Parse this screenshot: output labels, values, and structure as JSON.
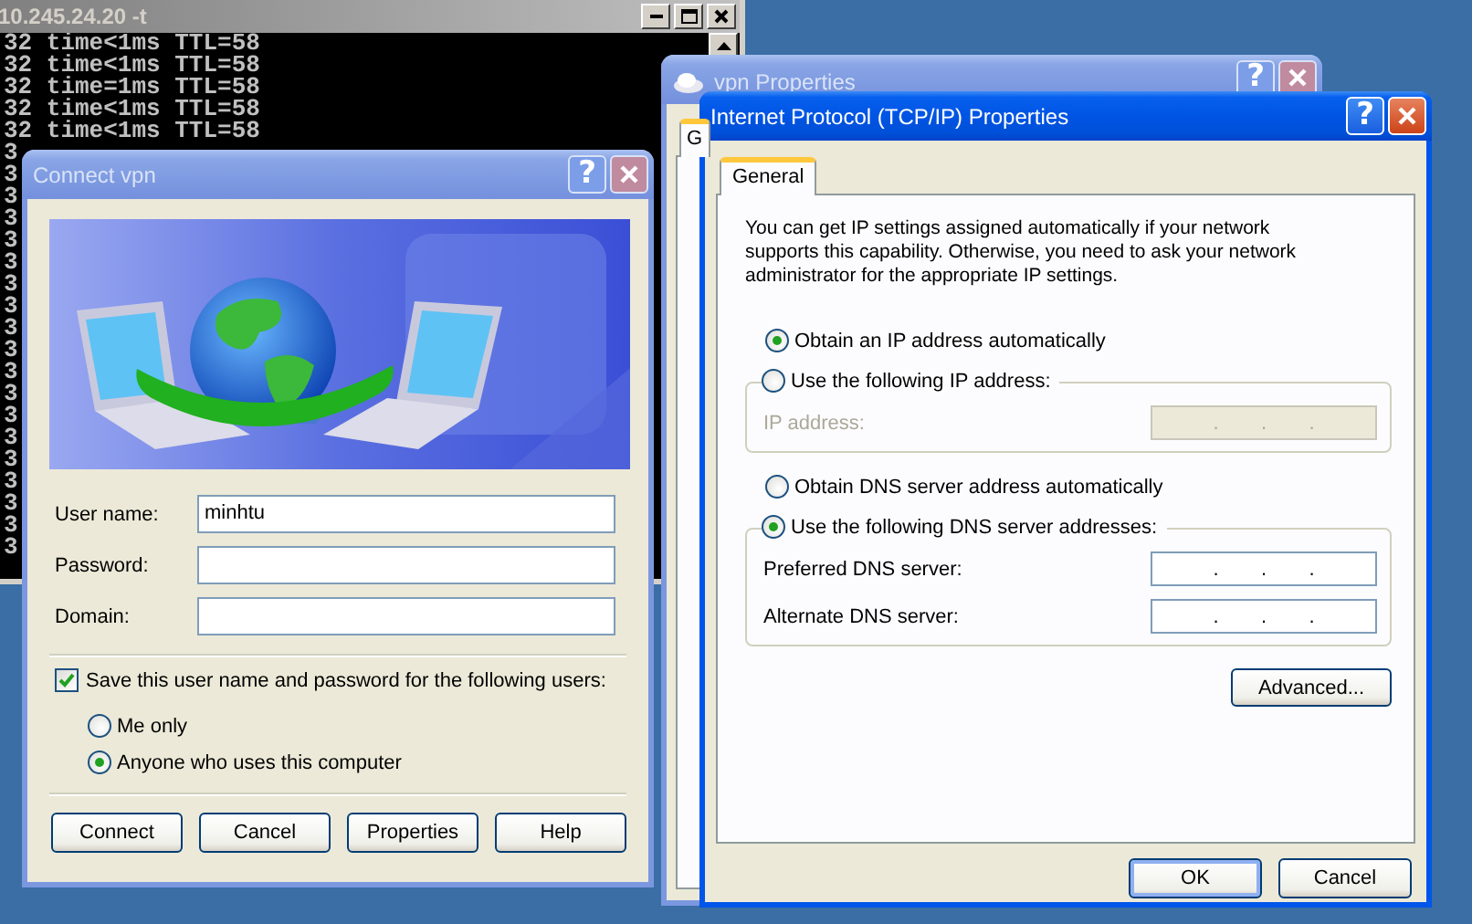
{
  "console": {
    "title": "10.245.24.20 -t",
    "active": false,
    "lines": [
      "32 time<1ms TTL=58",
      "32 time<1ms TTL=58",
      "32 time=1ms TTL=58",
      "32 time<1ms TTL=58",
      "32 time<1ms TTL=58",
      "3",
      "3",
      "3",
      "3",
      "3",
      "3",
      "3",
      "3",
      "3",
      "3",
      "3",
      "3",
      "3",
      "3",
      "3",
      "3",
      "3",
      "3",
      "3"
    ]
  },
  "vpn_properties": {
    "title": "vpn Properties",
    "active": false,
    "help_glyph": "?",
    "tabs": [
      {
        "label": "G",
        "selected": true
      }
    ]
  },
  "connect_dialog": {
    "title": "Connect vpn",
    "active": false,
    "help_glyph": "?",
    "fields": [
      {
        "label": "User name:",
        "value": "minhtu"
      },
      {
        "label": "Password:"
      },
      {
        "label": "Domain:"
      }
    ],
    "save_credentials": {
      "label": "Save this user name and password for the following users:",
      "checked": true
    },
    "save_for": [
      {
        "label": "Me only",
        "selected": false
      },
      {
        "label": "Anyone who uses this computer",
        "selected": true
      }
    ],
    "buttons": [
      {
        "label": "Connect",
        "default": false
      },
      {
        "label": "Cancel",
        "default": false
      },
      {
        "label": "Properties",
        "default": false
      },
      {
        "label": "Help",
        "default": false
      }
    ]
  },
  "tcpip_dialog": {
    "title": "Internet Protocol (TCP/IP) Properties",
    "active": true,
    "help_glyph": "?",
    "tabs": [
      {
        "label": "General",
        "selected": true
      }
    ],
    "description": "You can get IP settings assigned automatically if your network supports this capability. Otherwise, you need to ask your network administrator for the appropriate IP settings.",
    "ip_options": [
      {
        "label": "Obtain an IP address automatically",
        "selected": true
      },
      {
        "label": "Use the following IP address:",
        "selected": false,
        "fields": [
          {
            "label": "IP address:",
            "disabled": true,
            "separators": [
              ".",
              ".",
              "."
            ]
          }
        ]
      }
    ],
    "dns_options": [
      {
        "label": "Obtain DNS server address automatically",
        "selected": false
      },
      {
        "label": "Use the following DNS server addresses:",
        "selected": true,
        "fields": [
          {
            "label": "Preferred DNS server:",
            "disabled": false,
            "separators": [
              ".",
              ".",
              "."
            ]
          },
          {
            "label": "Alternate DNS server:",
            "disabled": false,
            "separators": [
              ".",
              ".",
              "."
            ]
          }
        ]
      }
    ],
    "advanced_button": "Advanced...",
    "buttons": [
      {
        "label": "OK",
        "default": true
      },
      {
        "label": "Cancel",
        "default": false
      }
    ]
  }
}
